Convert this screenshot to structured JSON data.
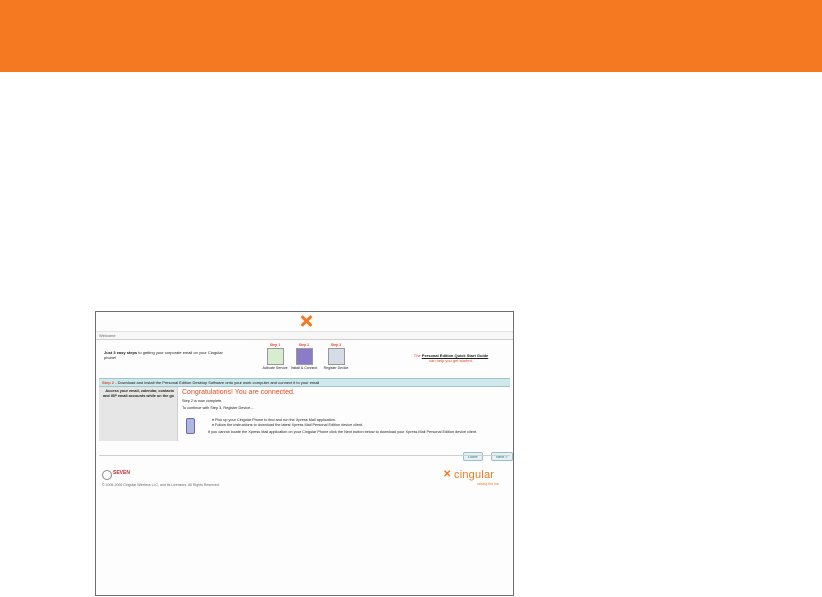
{
  "colors": {
    "brand_orange": "#f47920",
    "accent_red": "#e84c1e",
    "step_bar": "#d0e8ec"
  },
  "tab": {
    "label": "Welcome"
  },
  "intro": {
    "prefix": "Just",
    "highlight": "3 easy steps",
    "text": "to getting your corporate email on your Cingular phone!"
  },
  "steps": [
    {
      "label": "Step 1",
      "caption": "Activate Service",
      "icon": "pencil-check-icon"
    },
    {
      "label": "Step 2",
      "caption": "Install & Connect",
      "icon": "install-connect-icon"
    },
    {
      "label": "Step 3",
      "caption": "Register Device",
      "icon": "device-register-icon"
    }
  ],
  "guide": {
    "prefix": "The",
    "link": "Personal Edition Quick Start Guide",
    "sub": "can help you get started."
  },
  "stepbar": {
    "num": "Step 2",
    "text": "- Download and install the Personal Edition Desktop Software onto your work computer and connect it to your email"
  },
  "left_panel": {
    "text": "Access your email, calendar, contacts and ISP email accounts while on the go"
  },
  "content": {
    "title": "Congratulations! You are connected.",
    "line1": "Step 2 is now complete.",
    "line2": "To continue with Step 3, Register Device....",
    "bullet1": "Pick up your Cingular Phone to find and run the Xpress Mail application.",
    "bullet2": "Follow the instructions to download the latest Xpress Mail Personal Edition device client.",
    "note": "If you cannot locate the Xpress Mail application on your Cingular Phone click the Next button below to download your Xpress Mail Personal Edition device client."
  },
  "buttons": {
    "done": "Done",
    "next": "Next >"
  },
  "footer": {
    "seven": "SEVEN",
    "copyright": "© 2005-2006 Cingular Wireless LLC, and its Licensors. All Rights Reserved.",
    "cingular": "cingular",
    "tagline": "raising the bar"
  }
}
